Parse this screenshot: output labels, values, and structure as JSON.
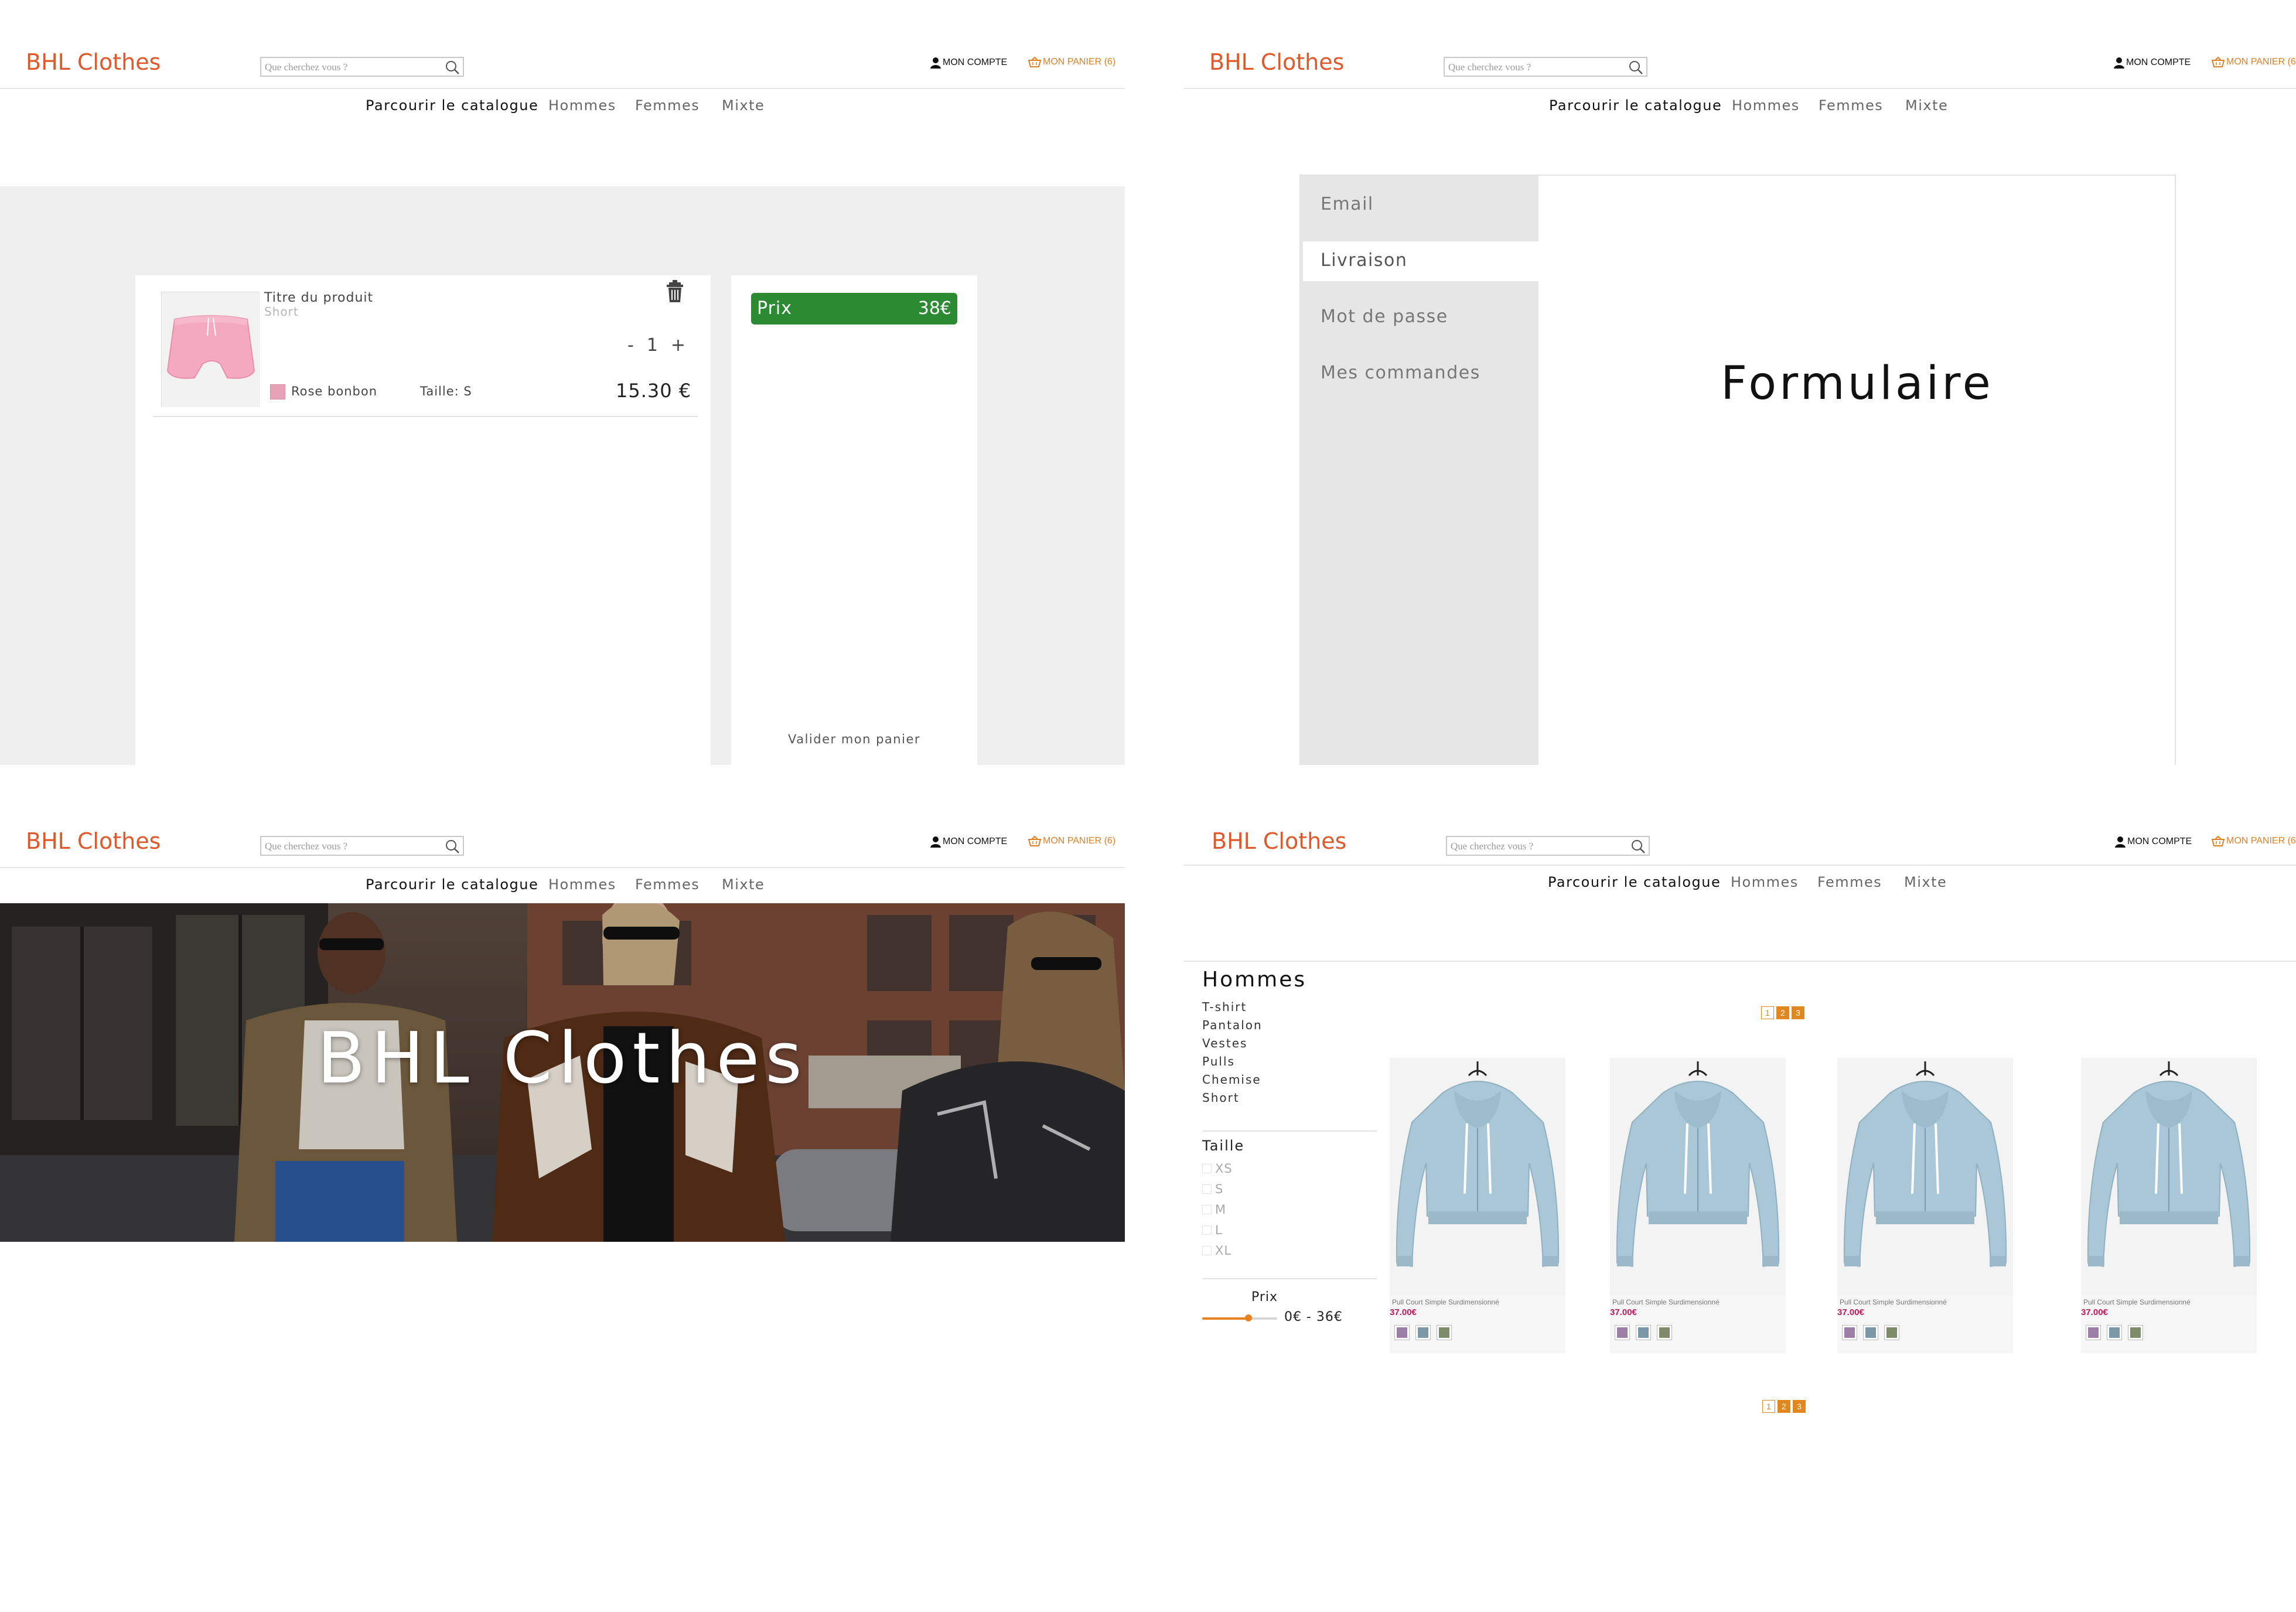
{
  "brand": "BHL Clothes",
  "header": {
    "search_placeholder": "Que cherchez vous ?",
    "account_label": "MON COMPTE",
    "cart_label": "MON PANIER (6)"
  },
  "nav": [
    "Parcourir le catalogue",
    "Hommes",
    "Femmes",
    "Mixte"
  ],
  "cart_page": {
    "item": {
      "title": "Titre du produit",
      "subtitle": "Short",
      "quantity": "1",
      "minus": "-",
      "plus": "+",
      "color_name": "Rose bonbon",
      "size": "Taille: S",
      "price": "15.30 €"
    },
    "summary": {
      "price_label": "Prix",
      "price_value": "38€",
      "validate_label": "Valider mon panier"
    }
  },
  "account_page": {
    "menu": [
      "Email",
      "Livraison",
      "Mot de passe",
      "Mes commandes"
    ],
    "active_index": 1,
    "form_title": "Formulaire"
  },
  "home_page": {
    "hero_title": "BHL Clothes"
  },
  "catalogue_page": {
    "category_title": "Hommes",
    "categories": [
      "T-shirt",
      "Pantalon",
      "Vestes",
      "Pulls",
      "Chemise",
      "Short"
    ],
    "size_title": "Taille",
    "sizes": [
      "XS",
      "S",
      "M",
      "L",
      "XL"
    ],
    "price_filter": {
      "title": "Prix",
      "range_text": "0€ - 36€",
      "value_fraction": 0.62
    },
    "pages": [
      "1",
      "2",
      "3"
    ],
    "current_page": "1",
    "products": [
      {
        "name": "Pull Court Simple Surdimensionné",
        "price": "37.00€"
      },
      {
        "name": "Pull Court Simple Surdimensionné",
        "price": "37.00€"
      },
      {
        "name": "Pull Court Simple Surdimensionné",
        "price": "37.00€"
      },
      {
        "name": "Pull Court Simple Surdimensionné",
        "price": "37.00€"
      }
    ],
    "swatch_colors": [
      "#9c7fa7",
      "#7b97a8",
      "#7f8a6a"
    ]
  },
  "colors": {
    "brand": "#e0592a",
    "cart_link": "#e0801e",
    "price_bar": "#2c8a32",
    "accent": "#e0871e",
    "product_price": "#c2185b",
    "pink_swatch": "#e8a2b8"
  },
  "icons": [
    "search-icon",
    "user-icon",
    "basket-icon",
    "trash-icon"
  ]
}
